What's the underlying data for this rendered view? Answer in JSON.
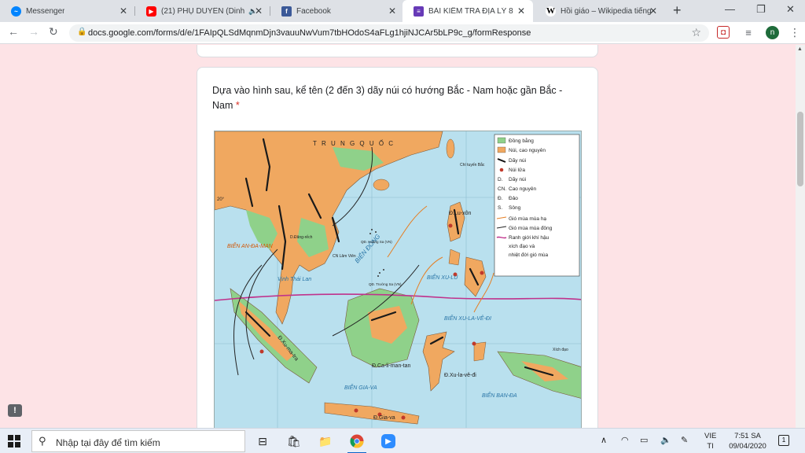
{
  "browser": {
    "tabs": [
      {
        "title": "Messenger",
        "icon": "messenger-icon",
        "color": "#0084ff"
      },
      {
        "title": "(21) PHỤ DUYÊN (Dinh",
        "icon": "youtube-icon",
        "color": "#ff0000"
      },
      {
        "title": "Facebook",
        "icon": "facebook-icon",
        "color": "#3b5998"
      },
      {
        "title": "BÀI KIỂM TRA ĐỊA LÝ 8",
        "icon": "google-forms-icon",
        "color": "#673ab7",
        "active": true
      },
      {
        "title": "Hồi giáo – Wikipedia tiếng",
        "icon": "wikipedia-icon",
        "color": "#000000"
      }
    ],
    "url": "docs.google.com/forms/d/e/1FAIpQLSdMqnmDjn3vauuNwVum7tbHOdoS4aFLg1hjiNJCAr5bLP9c_g/formResponse",
    "profile_initial": "n"
  },
  "form": {
    "question": "Dựa vào hình sau, kể tên (2 đến 3) dãy núi có hướng Bắc - Nam hoặc gần Bắc - Nam",
    "required_mark": "*"
  },
  "map": {
    "country_label": "T R U N G   Q U Ố C",
    "tropic_label": "Chí tuyến Bắc",
    "lat_label": "20°",
    "legend": [
      {
        "label": "Đồng bằng",
        "symbol": "plain-swatch",
        "color": "#8fd18a"
      },
      {
        "label": "Núi, cao nguyên",
        "symbol": "mountain-swatch",
        "color": "#f0a860"
      },
      {
        "label": "Dãy núi",
        "symbol": "range-line"
      },
      {
        "label": "Núi lửa",
        "symbol": "volcano-dot",
        "color": "#c0392b"
      },
      {
        "label": "Dãy núi",
        "symbol": "D."
      },
      {
        "label": "Cao nguyên",
        "symbol": "CN."
      },
      {
        "label": "Đảo",
        "symbol": "Đ."
      },
      {
        "label": "Sông",
        "symbol": "S."
      },
      {
        "label": "Gió mùa mùa hạ",
        "symbol": "summer-arrow",
        "color": "#e67e22"
      },
      {
        "label": "Gió mùa mùa đông",
        "symbol": "winter-arrow",
        "color": "#222222"
      },
      {
        "label": "Ranh giới khí hậu",
        "symbol": "climate-line",
        "color": "#c0328c"
      },
      {
        "label": "xích đạo và",
        "symbol": ""
      },
      {
        "label": "nhiệt đới gió mùa",
        "symbol": ""
      }
    ],
    "places": {
      "an_da_man": "BIỂN AN-ĐA-MAN",
      "vinh_thai_lan": "Vịnh Thái Lan",
      "bien_dong": "BIỂN ĐÔNG",
      "xu_lu": "BIỂN XU-LU",
      "xu_la_ve_di_sea": "BIỂN XU-LA-VÊ-ĐI",
      "gia_va_sea": "BIỂN GIA-VA",
      "ban_da": "BIỂN BAN-ĐA",
      "lu_xon": "Đ.Lu-xôn",
      "ca_li_man_tan": "Đ.Ca-li-man-tan",
      "xu_la_ve_di": "Đ.Xu-la-vê-đi",
      "gia_va": "Đ.Gia-va",
      "xu_ma_tra": "Đ.Xu-ma-tra",
      "hoang_sa": "QĐ. Hoàng Sa (VN)",
      "truong_sa": "QĐ. Trường Sa (VN)",
      "xich_dao": "Xích đạo",
      "dang_rech": "D.Đăng-rếch",
      "lam_vien": "CN Lâm Viên"
    }
  },
  "taskbar": {
    "search_placeholder": "Nhập tại đây để tìm kiếm",
    "lang_top": "VIE",
    "lang_bottom": "TI",
    "time": "7:51 SA",
    "date": "09/04/2020",
    "notification_count": "1"
  }
}
